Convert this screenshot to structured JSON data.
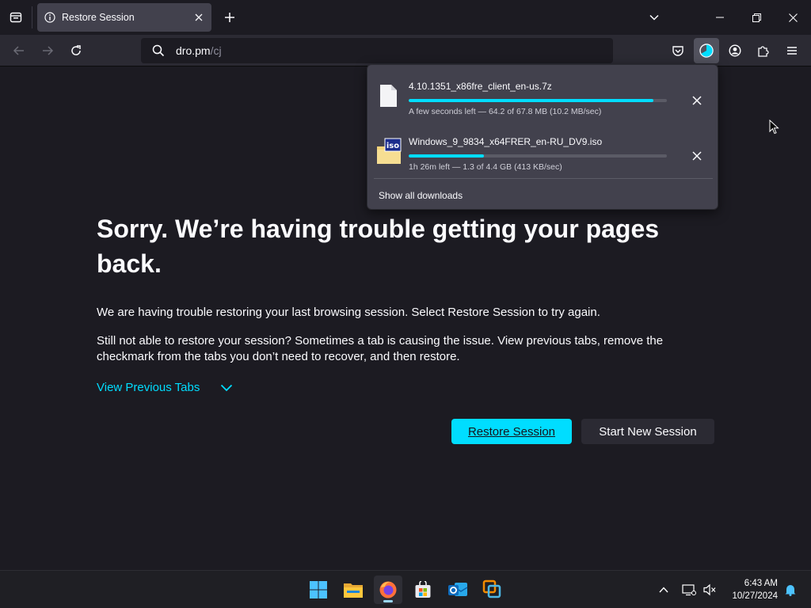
{
  "browser": {
    "tab": {
      "title": "Restore Session",
      "icon": "info-icon"
    },
    "url": {
      "host": "dro.pm",
      "path": "/cj"
    }
  },
  "page": {
    "heading": "Sorry. We’re having trouble getting your pages back.",
    "para1": "We are having trouble restoring your last browsing session. Select Restore Session to try again.",
    "para2": "Still not able to restore your session? Sometimes a tab is causing the issue. View previous tabs, remove the checkmark from the tabs you don’t need to recover, and then restore.",
    "view_previous_tabs": "View Previous Tabs",
    "restore_button": "Restore Session",
    "new_session_button": "Start New Session"
  },
  "downloads": {
    "items": [
      {
        "name": "4.10.1351_x86fre_client_en-us.7z",
        "status": "A few seconds left — 64.2 of 67.8 MB (10.2 MB/sec)",
        "progress": 0.947,
        "icon": "file-icon"
      },
      {
        "name": "Windows_9_9834_x64FRER_en-RU_DV9.iso",
        "status": "1h 26m left — 1.3 of 4.4 GB (413 KB/sec)",
        "progress": 0.29,
        "icon": "iso-file-icon"
      }
    ],
    "show_all": "Show all downloads"
  },
  "taskbar": {
    "time": "6:43 AM",
    "date": "10/27/2024",
    "apps": [
      "windows-start-icon",
      "file-explorer-icon",
      "firefox-icon",
      "microsoft-store-icon",
      "outlook-icon",
      "vmware-icon"
    ]
  },
  "colors": {
    "accent": "#00ddff",
    "page_bg": "#1c1b22",
    "toolbar_bg": "#2b2a33",
    "panel_bg": "#42414d"
  }
}
